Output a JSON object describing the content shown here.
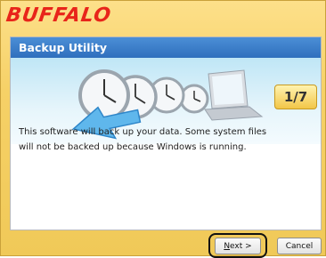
{
  "brand": {
    "logo_text": "BUFFALO",
    "color": "#e8251a"
  },
  "header": {
    "title": "Backup Utility",
    "step": "1/7"
  },
  "content": {
    "line1": "This software will back up your data. Some system files",
    "line2": "will not be backed up because Windows is running."
  },
  "footer": {
    "next_label_accel": "N",
    "next_label_rest": "ext >",
    "cancel_label": "Cancel"
  },
  "colors": {
    "title_bar": "#2f6fbd",
    "window_bg": "#f6d167",
    "badge": "#f2c648"
  },
  "icons": [
    "arrow-icon",
    "clock-icon",
    "laptop-icon"
  ]
}
